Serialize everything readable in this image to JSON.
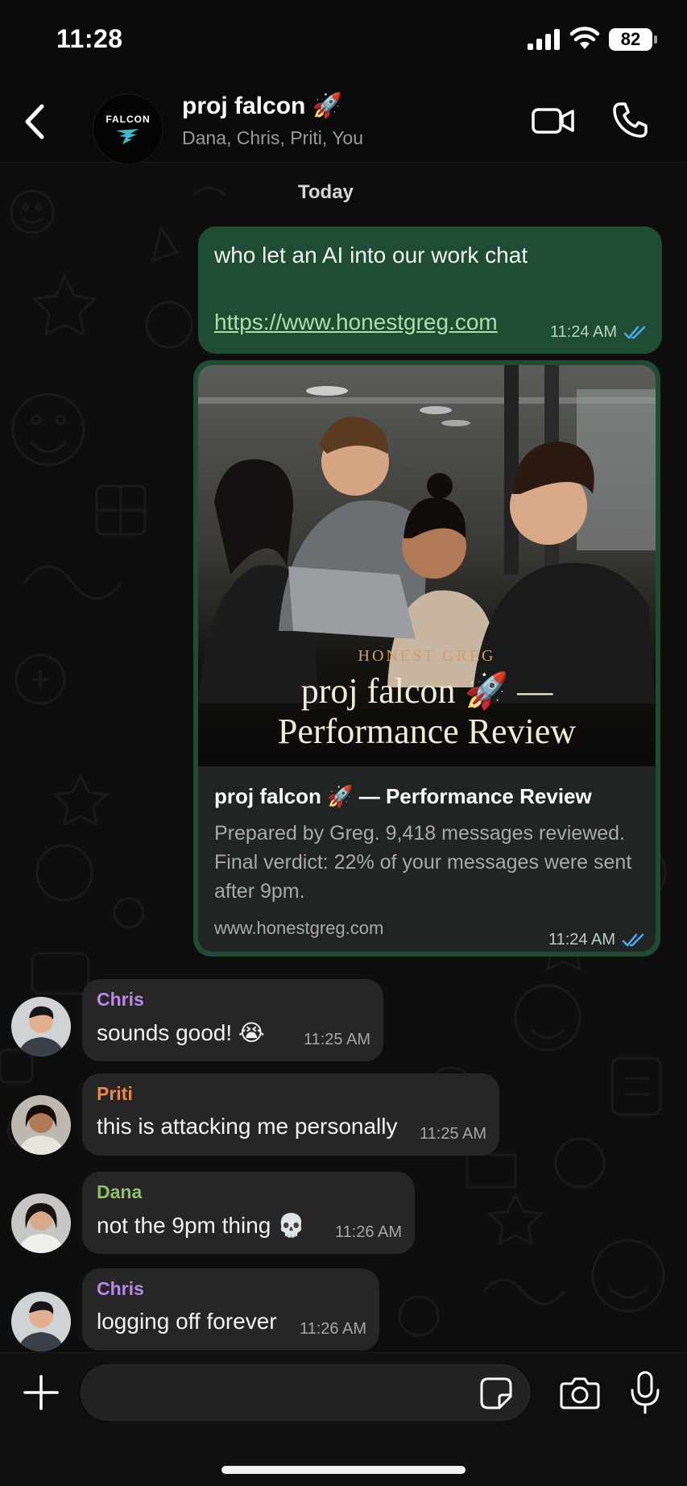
{
  "status_bar": {
    "time": "11:28",
    "battery": "82"
  },
  "header": {
    "group_logo_text": "FALCON",
    "title": "proj falcon 🚀",
    "members": "Dana, Chris, Priti, You"
  },
  "chat": {
    "date_label": "Today",
    "outgoing": [
      {
        "text": "who let an AI into our work chat",
        "link": "https://www.honestgreg.com",
        "time": "11:24 AM"
      }
    ],
    "link_preview": {
      "brand": "HONEST GREG",
      "image_title_line1": "proj falcon 🚀 —",
      "image_title_line2": "Performance Review",
      "title": "proj falcon 🚀 — Performance Review",
      "description": "Prepared by Greg. 9,418 messages reviewed. Final verdict: 22% of your messages were sent after 9pm.",
      "domain": "www.honestgreg.com",
      "time": "11:24 AM"
    },
    "incoming": [
      {
        "sender": "Chris",
        "text": "sounds good! 😭",
        "time": "11:25 AM",
        "color": "#b88ae6"
      },
      {
        "sender": "Priti",
        "text": "this is attacking me personally",
        "time": "11:25 AM",
        "color": "#f0874a"
      },
      {
        "sender": "Dana",
        "text": "not the 9pm thing 💀",
        "time": "11:26 AM",
        "color": "#8fbf6a"
      },
      {
        "sender": "Chris",
        "text": "logging off forever",
        "time": "11:26 AM",
        "color": "#b88ae6"
      }
    ]
  },
  "composer": {
    "placeholder": ""
  },
  "icons": [
    "back-icon",
    "video-call-icon",
    "phone-icon",
    "plus-icon",
    "sticker-icon",
    "camera-icon",
    "mic-icon",
    "read-receipt-icon"
  ]
}
